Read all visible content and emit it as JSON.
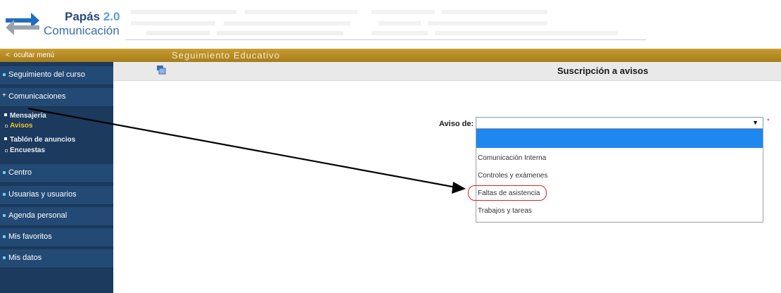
{
  "header": {
    "brand": "Papás",
    "brand_version": "2.0",
    "brand_sub": "Comunicación"
  },
  "nav": {
    "hide_menu": "ocultar menú",
    "section_title": "Seguimiento Educativo"
  },
  "sidebar": {
    "items": [
      {
        "label": "Seguimiento del curso"
      },
      {
        "label": "Comunicaciones"
      },
      {
        "label": "Centro"
      },
      {
        "label": "Usuarias y usuarios"
      },
      {
        "label": "Agenda personal"
      },
      {
        "label": "Mis favoritos"
      },
      {
        "label": "Mis datos"
      }
    ],
    "sub_items": [
      {
        "label": "Mensajería"
      },
      {
        "label": "Avisos"
      },
      {
        "label": "Tablón de anuncios"
      },
      {
        "label": "Encuestas"
      }
    ]
  },
  "main": {
    "title": "Suscripción a avisos",
    "aviso_label": "Aviso de:",
    "required_mark": "*",
    "select_value": "",
    "options": [
      {
        "label": "Comunicación Interna"
      },
      {
        "label": "Controles y exámenes"
      },
      {
        "label": "Faltas de asistencia"
      },
      {
        "label": "Trabajos y tareas"
      }
    ]
  },
  "colors": {
    "gold": "#b58a25",
    "sidebar": "#1b3a5e",
    "highlight": "#1e87f0",
    "active": "#f1c232"
  }
}
